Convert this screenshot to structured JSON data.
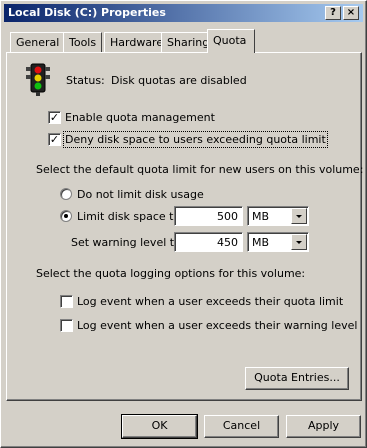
{
  "window": {
    "title": "Local Disk (C:) Properties",
    "help_label": "?",
    "close_label": "×"
  },
  "tabs": [
    {
      "label": "General"
    },
    {
      "label": "Tools"
    },
    {
      "label": "Hardware"
    },
    {
      "label": "Sharing"
    },
    {
      "label": "Quota",
      "active": true
    }
  ],
  "quota": {
    "status_label": "Status:",
    "status_value": "Disk quotas are disabled",
    "enable_quota_label": "Enable quota management",
    "enable_quota_checked": true,
    "deny_space_label": "Deny disk space to users exceeding quota limit",
    "deny_space_checked": true,
    "default_limit_heading": "Select the default quota limit for new users on this volume:",
    "no_limit_label": "Do not limit disk usage",
    "limit_label": "Limit disk space to",
    "limit_value": "500",
    "limit_unit": "MB",
    "warning_label": "Set warning level to",
    "warning_value": "450",
    "warning_unit": "MB",
    "logging_heading": "Select the quota logging options for this volume:",
    "log_limit_label": "Log event when a user exceeds their quota limit",
    "log_warning_label": "Log event when a user exceeds their warning level",
    "entries_button": "Quota Entries..."
  },
  "footer": {
    "ok": "OK",
    "cancel": "Cancel",
    "apply": "Apply"
  },
  "colors": {
    "face": "#d4d0c8",
    "title_start": "#0a246a",
    "title_end": "#a6caf0"
  },
  "icons": {
    "status": "traffic-light-icon"
  }
}
